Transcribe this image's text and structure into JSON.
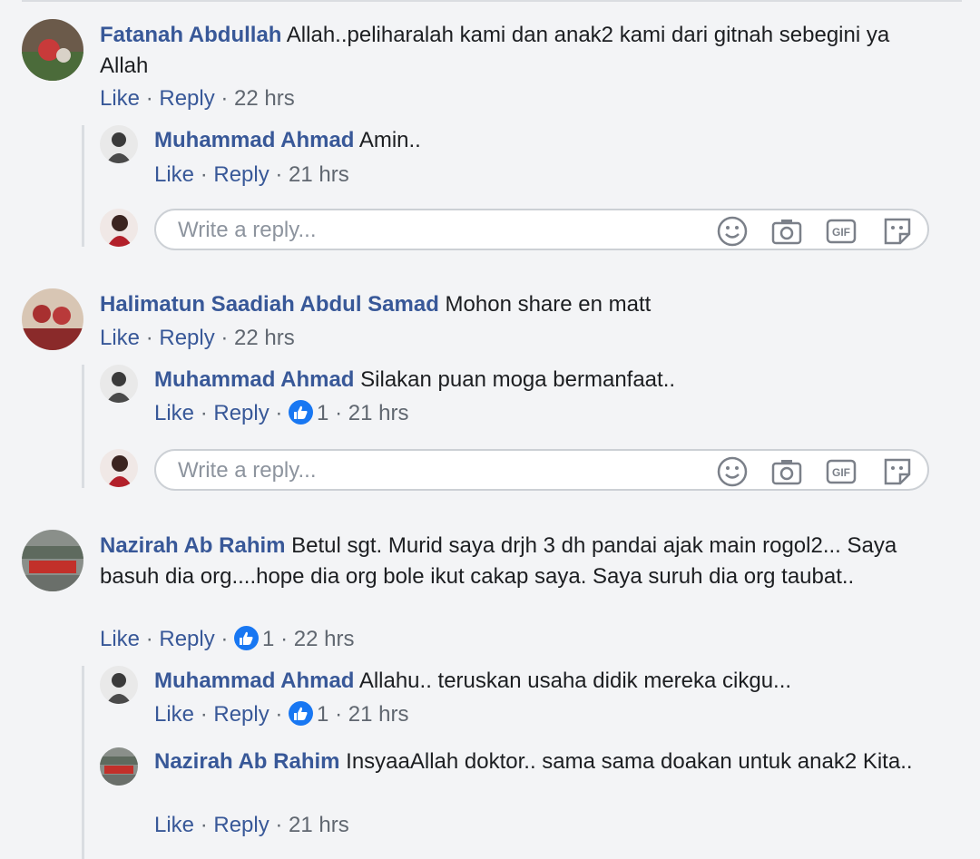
{
  "actions": {
    "like": "Like",
    "reply": "Reply",
    "sep": " · "
  },
  "reply_placeholder": "Write a reply...",
  "colors": {
    "link": "#385898",
    "meta": "#606770",
    "like_badge": "#1877f2",
    "thread_line": "#dadde1"
  },
  "comments": [
    {
      "author": "Fatanah Abdullah",
      "text": "Allah..peliharalah kami dan anak2 kami dari gitnah sebegini ya Allah",
      "time": "22 hrs",
      "replies": [
        {
          "author": "Muhammad Ahmad",
          "text": "Amin..",
          "time": "21 hrs"
        }
      ]
    },
    {
      "author": "Halimatun Saadiah Abdul Samad",
      "text": "Mohon share en matt",
      "time": "22 hrs",
      "replies": [
        {
          "author": "Muhammad Ahmad",
          "text": "Silakan puan moga bermanfaat..",
          "likes": "1",
          "time": "21 hrs"
        }
      ]
    },
    {
      "author": "Nazirah Ab Rahim",
      "text": "Betul sgt. Murid saya drjh 3 dh pandai ajak main rogol2... Saya basuh dia org....hope dia org bole ikut cakap saya. Saya suruh dia org taubat..",
      "likes": "1",
      "time": "22 hrs",
      "replies": [
        {
          "author": "Muhammad Ahmad",
          "text": "Allahu.. teruskan usaha didik mereka cikgu...",
          "likes": "1",
          "time": "21 hrs"
        },
        {
          "author": "Nazirah Ab Rahim",
          "text": "InsyaaAllah doktor.. sama sama doakan untuk anak2 Kita..",
          "time": "21 hrs"
        }
      ]
    }
  ],
  "reply_box_icons": [
    "emoji-icon",
    "camera-icon",
    "gif-icon",
    "sticker-icon"
  ]
}
